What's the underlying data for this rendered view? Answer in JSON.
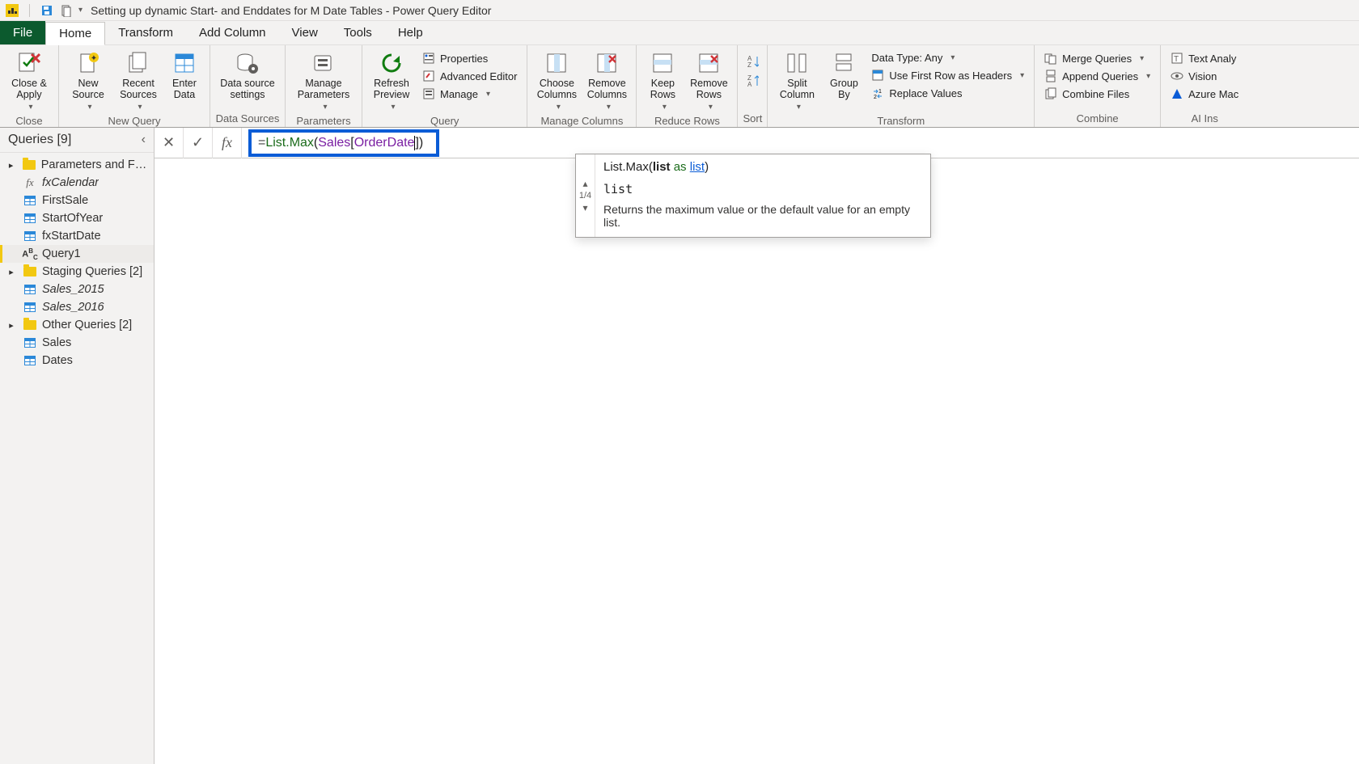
{
  "titlebar": {
    "title": "Setting up dynamic Start- and Enddates for M Date Tables - Power Query Editor"
  },
  "tabs": {
    "file": "File",
    "home": "Home",
    "transform": "Transform",
    "addcol": "Add Column",
    "view": "View",
    "tools": "Tools",
    "help": "Help"
  },
  "ribbon": {
    "close": {
      "closeapply": "Close &\nApply",
      "group": "Close"
    },
    "newquery": {
      "newsource": "New\nSource",
      "recent": "Recent\nSources",
      "enterdata": "Enter\nData",
      "group": "New Query"
    },
    "datasources": {
      "settings": "Data source\nsettings",
      "group": "Data Sources"
    },
    "params": {
      "manage": "Manage\nParameters",
      "group": "Parameters"
    },
    "query": {
      "refresh": "Refresh\nPreview",
      "properties": "Properties",
      "advanced": "Advanced Editor",
      "manage": "Manage",
      "group": "Query"
    },
    "managecols": {
      "choose": "Choose\nColumns",
      "remove": "Remove\nColumns",
      "group": "Manage Columns"
    },
    "reducerows": {
      "keep": "Keep\nRows",
      "removerows": "Remove\nRows",
      "group": "Reduce Rows"
    },
    "sort": {
      "group": "Sort"
    },
    "transform": {
      "split": "Split\nColumn",
      "groupby": "Group\nBy",
      "datatype": "Data Type: Any",
      "firstrow": "Use First Row as Headers",
      "replace": "Replace Values",
      "group": "Transform"
    },
    "combine": {
      "merge": "Merge Queries",
      "append": "Append Queries",
      "combinefiles": "Combine Files",
      "group": "Combine"
    },
    "ai": {
      "text": "Text Analy",
      "vision": "Vision",
      "azure": "Azure Mac",
      "group": "AI Ins"
    }
  },
  "sidebar": {
    "header": "Queries [9]",
    "g1": {
      "label": "Parameters and Fu…",
      "items": [
        {
          "icon": "fx",
          "label": "fxCalendar",
          "italic": true
        },
        {
          "icon": "table",
          "label": "FirstSale"
        },
        {
          "icon": "table",
          "label": "StartOfYear"
        },
        {
          "icon": "table",
          "label": "fxStartDate"
        },
        {
          "icon": "abc",
          "label": "Query1",
          "selected": true
        }
      ]
    },
    "g2": {
      "label": "Staging Queries [2]",
      "items": [
        {
          "icon": "table",
          "label": "Sales_2015",
          "italic": true
        },
        {
          "icon": "table",
          "label": "Sales_2016",
          "italic": true
        }
      ]
    },
    "g3": {
      "label": "Other Queries [2]",
      "items": [
        {
          "icon": "table",
          "label": "Sales"
        },
        {
          "icon": "table",
          "label": "Dates"
        }
      ]
    }
  },
  "formula": {
    "eq": "= ",
    "fn": "List.Max",
    "open": "(",
    "t1": "Sales",
    "b1": "[",
    "t2": "OrderDate",
    "b2": "]",
    "close": ")"
  },
  "popup": {
    "sig_fn": "List.Max",
    "sig_open": "(",
    "sig_p": "list",
    "sig_as": " as ",
    "sig_type": "list",
    "sig_close": ")",
    "counter": "1/4",
    "current": "list",
    "desc": "Returns the maximum value or the default value for an empty list."
  }
}
